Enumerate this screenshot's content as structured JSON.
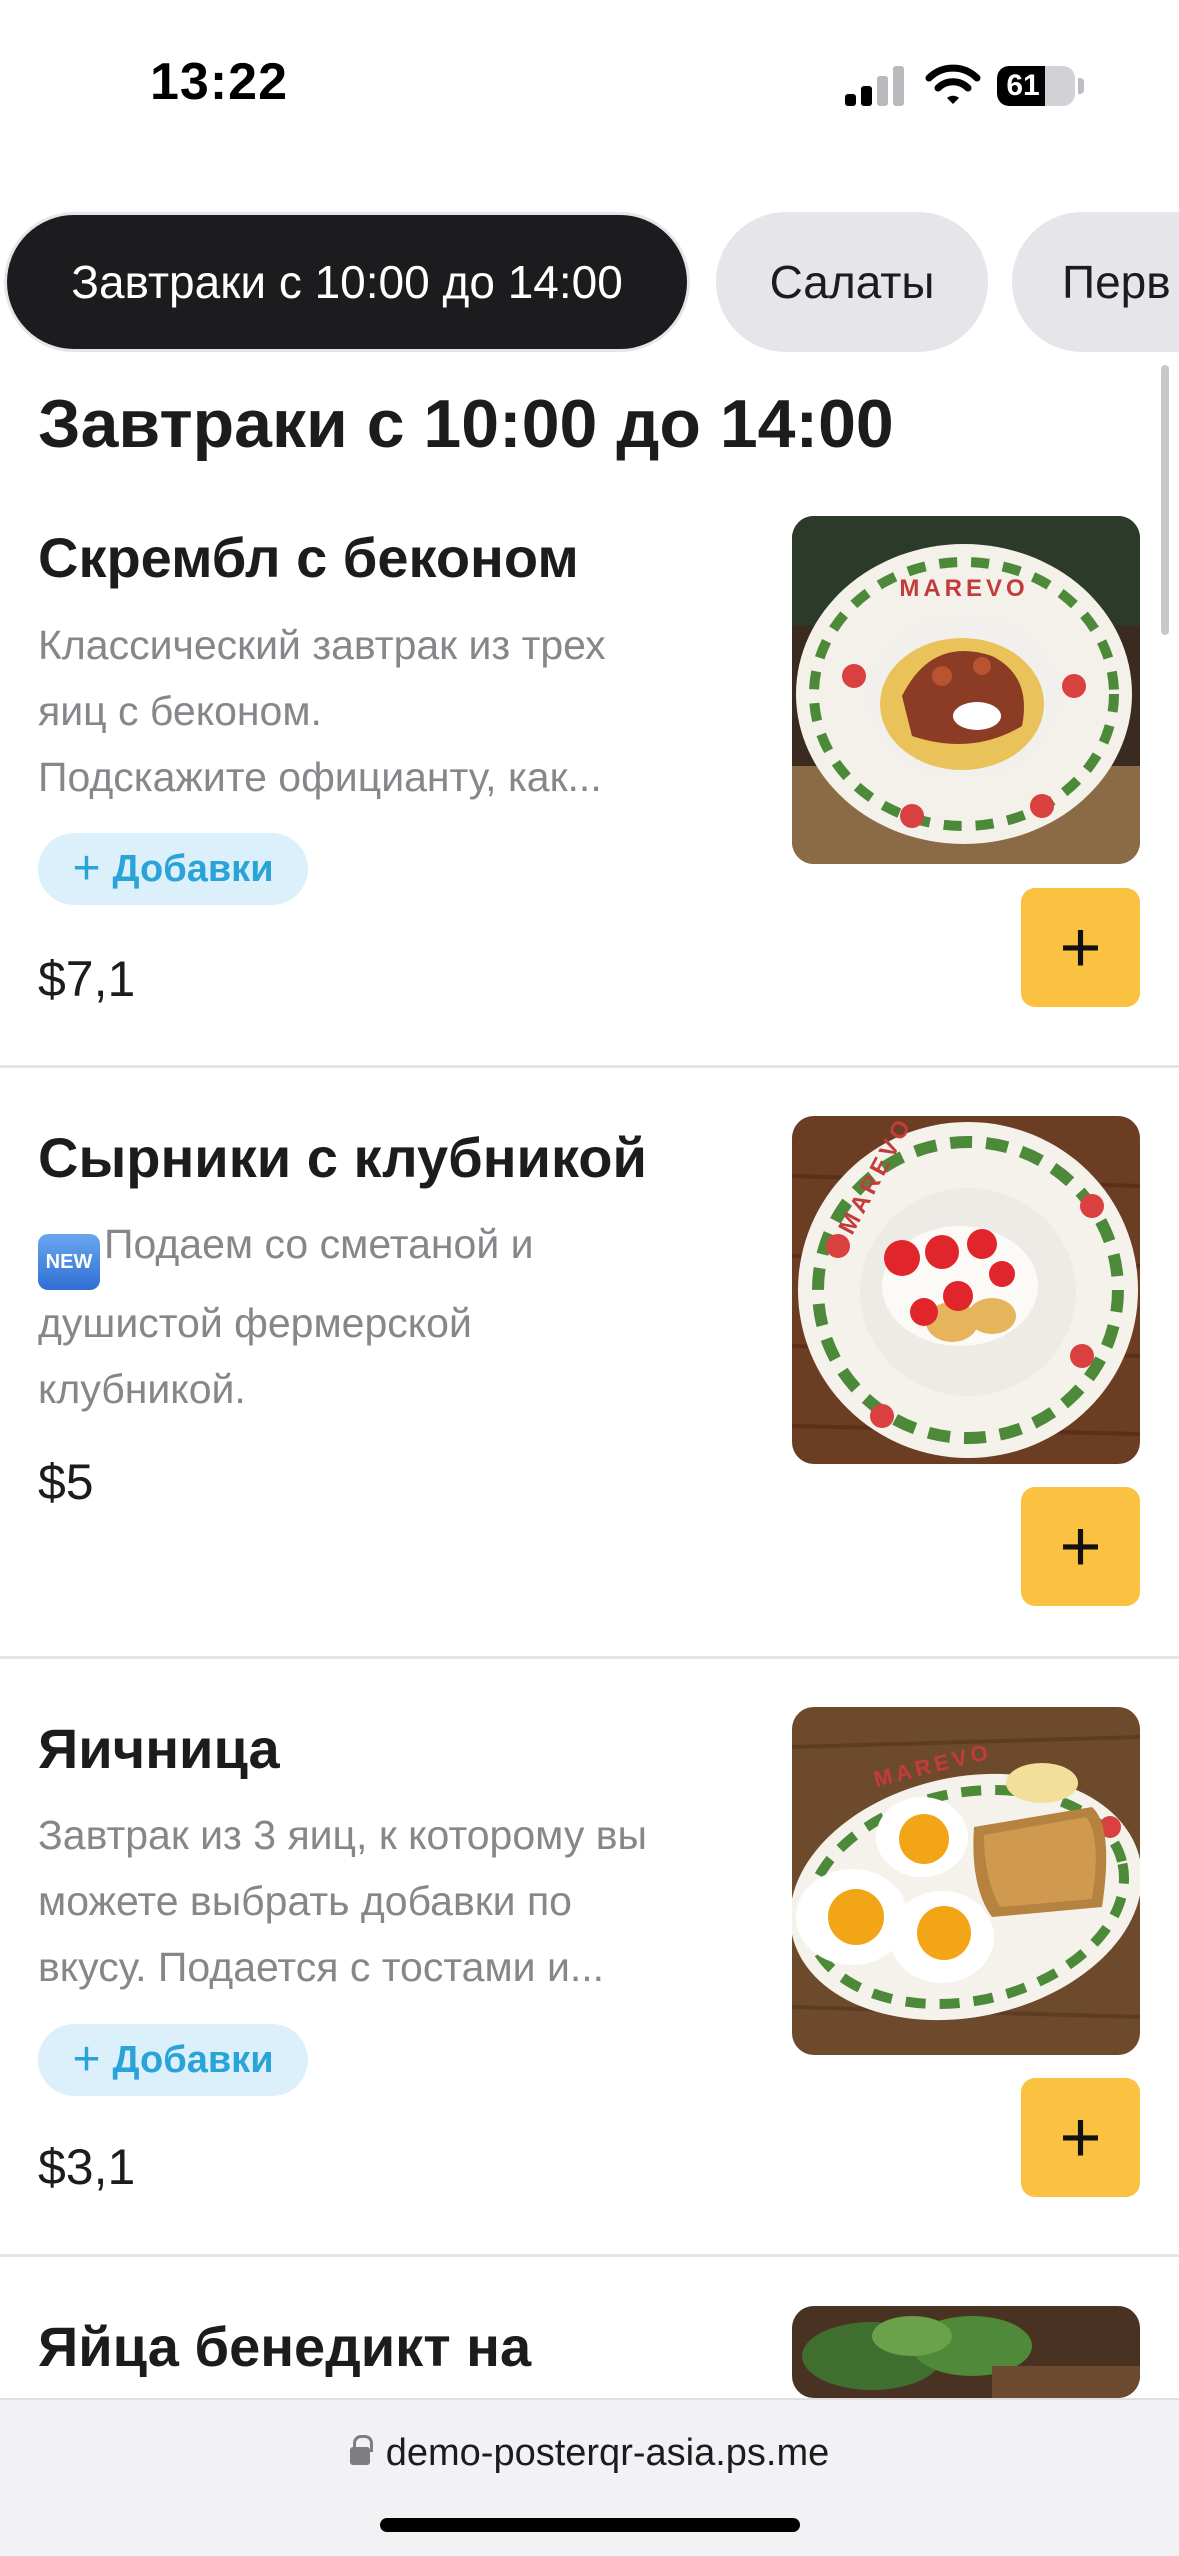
{
  "status_bar": {
    "time": "13:22",
    "battery": "61",
    "battery_level": 0.61
  },
  "categories": [
    {
      "label": "Завтраки с 10:00 до 14:00",
      "active": true
    },
    {
      "label": "Салаты",
      "active": false
    },
    {
      "label": "Перв",
      "active": false
    }
  ],
  "section": {
    "title": "Завтраки с 10:00 до 14:00"
  },
  "items": [
    {
      "name": "Скрембл с беконом",
      "desc_lines": [
        "Классический завтрак из трех",
        "яиц с беконом.",
        "Подскажите официанту, как..."
      ],
      "addons_label": "Добавки",
      "price": "$7,1",
      "photo_text": "MAREVO"
    },
    {
      "name": "Сырники с клубникой",
      "new_badge": "NEW",
      "desc_lines": [
        "Подаем со сметаной и",
        "душистой фермерской",
        "клубникой."
      ],
      "price": "$5",
      "photo_text": "MAREVO"
    },
    {
      "name": "Яичница",
      "desc_lines": [
        "Завтрак из 3 яиц, к которому вы",
        "можете выбрать добавки по",
        "вкусу. Подается с тостами и..."
      ],
      "addons_label": "Добавки",
      "price": "$3,1",
      "photo_text": "MAREVO"
    },
    {
      "name": "Яйца бенедикт на"
    }
  ],
  "add_button_label": "+",
  "addons_plus": "+",
  "browser": {
    "url": "demo-posterqr-asia.ps.me"
  },
  "colors": {
    "accent_yellow": "#fbc241",
    "addons_bg": "#dcf0fb",
    "addons_text": "#2aa4d8",
    "pill_active_bg": "#1c1c1e",
    "pill_bg": "#e5e5ea"
  }
}
